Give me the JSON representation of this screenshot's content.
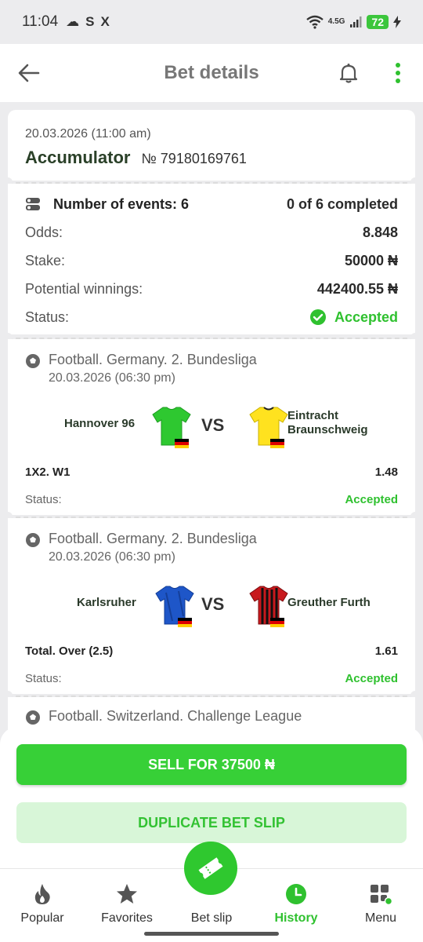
{
  "status_bar": {
    "time": "11:04",
    "network": "4.5G",
    "battery": "72"
  },
  "header": {
    "title": "Bet details"
  },
  "bet": {
    "date": "20.03.2026 (11:00 am)",
    "type": "Accumulator",
    "number": "№ 79180169761",
    "events_label": "Number of events: 6",
    "completed": "0 of 6 completed",
    "odds_label": "Odds:",
    "odds_value": "8.848",
    "stake_label": "Stake:",
    "stake_value": "50000 ₦",
    "winnings_label": "Potential winnings:",
    "winnings_value": "442400.55 ₦",
    "status_label": "Status:",
    "status_value": "Accepted"
  },
  "events": [
    {
      "league": "Football. Germany. 2. Bundesliga",
      "date": "20.03.2026 (06:30 pm)",
      "home": "Hannover 96",
      "away_line1": "Eintracht",
      "away_line2": "Braunschweig",
      "vs": "VS",
      "market": "1X2. W1",
      "odds": "1.48",
      "status_label": "Status:",
      "status_value": "Accepted",
      "home_color": "#2ec830",
      "away_color": "#ffe21f"
    },
    {
      "league": "Football. Germany. 2. Bundesliga",
      "date": "20.03.2026 (06:30 pm)",
      "home": "Karlsruher",
      "away_line1": "Greuther Furth",
      "away_line2": "",
      "vs": "VS",
      "market": "Total. Over (2.5)",
      "odds": "1.61",
      "status_label": "Status:",
      "status_value": "Accepted",
      "home_color": "#1e56c8",
      "away_color": "#c8191d"
    },
    {
      "league": "Football. Switzerland. Challenge League"
    }
  ],
  "actions": {
    "sell": "SELL FOR 37500 ₦",
    "duplicate": "DUPLICATE BET SLIP"
  },
  "nav": [
    {
      "label": "Popular",
      "icon": "flame-icon"
    },
    {
      "label": "Favorites",
      "icon": "star-icon"
    },
    {
      "label": "Bet slip",
      "icon": "ticket-icon"
    },
    {
      "label": "History",
      "icon": "clock-icon"
    },
    {
      "label": "Menu",
      "icon": "grid-icon"
    }
  ],
  "colors": {
    "accent": "#37d037",
    "header_text": "#777777"
  }
}
